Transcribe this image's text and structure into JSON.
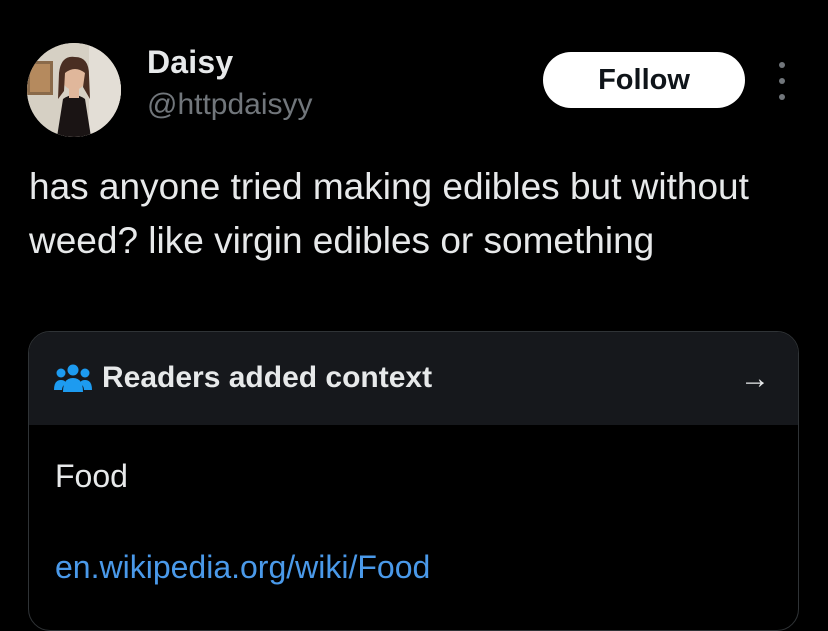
{
  "author": {
    "name": "Daisy",
    "handle": "@httpdaisyy"
  },
  "follow_button": {
    "label": "Follow"
  },
  "more_menu": {
    "icon": "more-vertical-icon"
  },
  "tweet": {
    "text": "has anyone tried making edibles but without weed? like virgin edibles or something"
  },
  "community_note": {
    "header": {
      "icon": "readers-icon",
      "title": "Readers added context",
      "arrow": "→"
    },
    "note_text": "Food",
    "link_text": "en.wikipedia.org/wiki/Food"
  },
  "colors": {
    "background": "#000000",
    "primary_text": "#e7e9ea",
    "secondary_text": "#71767b",
    "link": "#4a99e9",
    "readers_icon": "#1d9bf0",
    "card_header_bg": "#16181c",
    "card_border": "#2f3336"
  }
}
